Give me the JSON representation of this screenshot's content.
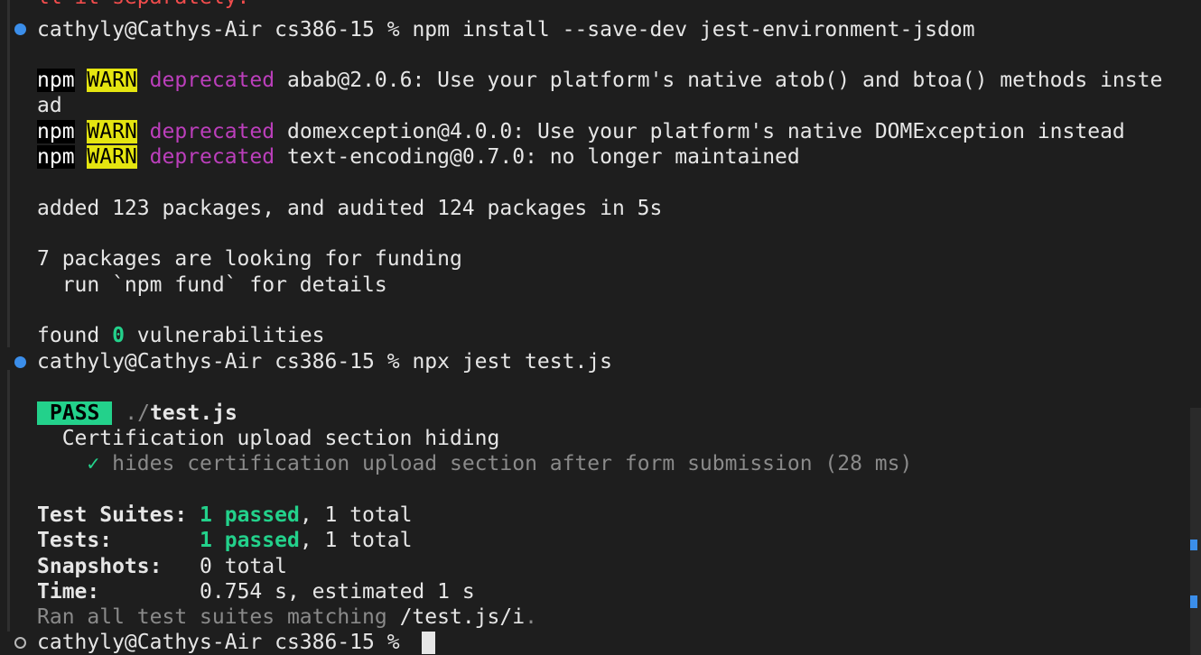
{
  "terminal": {
    "top_line_fragment": "ll it separately.",
    "prompt": "cathyly@Cathys-Air cs386-15 %",
    "cmd_install": "npm install --save-dev jest-environment-jsdom",
    "npm_label": "npm",
    "warn_label": "WARN",
    "deprecated_label": "deprecated",
    "warn1_text": "abab@2.0.6: Use your platform's native atob() and btoa() methods inste",
    "warn1_wrap": "ad",
    "warn2_text": "domexception@4.0.0: Use your platform's native DOMException instead",
    "warn3_text": "text-encoding@0.7.0: no longer maintained",
    "added_line": "added 123 packages, and audited 124 packages in 5s",
    "funding_line": "7 packages are looking for funding",
    "fund_hint": "  run `npm fund` for details",
    "found_prefix": "found ",
    "found_count": "0",
    "found_suffix": " vulnerabilities",
    "cmd_jest": "npx jest test.js",
    "pass_badge": "PASS",
    "test_path_dir": "./",
    "test_path_file": "test.js",
    "describe_name": "  Certification upload section hiding",
    "check_mark": "✓",
    "test_case": "hides certification upload section after form submission (28 ms)",
    "summary": {
      "suites_label": "Test Suites:",
      "suites_passed": "1 passed",
      "suites_total": ", 1 total",
      "tests_label": "Tests:",
      "tests_passed": "1 passed",
      "tests_total": ", 1 total",
      "snapshots_label": "Snapshots:",
      "snapshots_value": "0 total",
      "time_label": "Time:",
      "time_value": "0.754 s, estimated 1 s"
    },
    "ran_prefix": "Ran all test suites matching ",
    "ran_pattern": "/test.js/i",
    "ran_suffix": "."
  },
  "colors": {
    "background": "#1e1e1e",
    "text": "#e6e6e6",
    "deprecated": "#bc3fbc",
    "warn_bg": "#e5e510",
    "pass_bg": "#23d18b",
    "decoration_ok": "#3b8eea",
    "error_red": "#f14c4c"
  }
}
